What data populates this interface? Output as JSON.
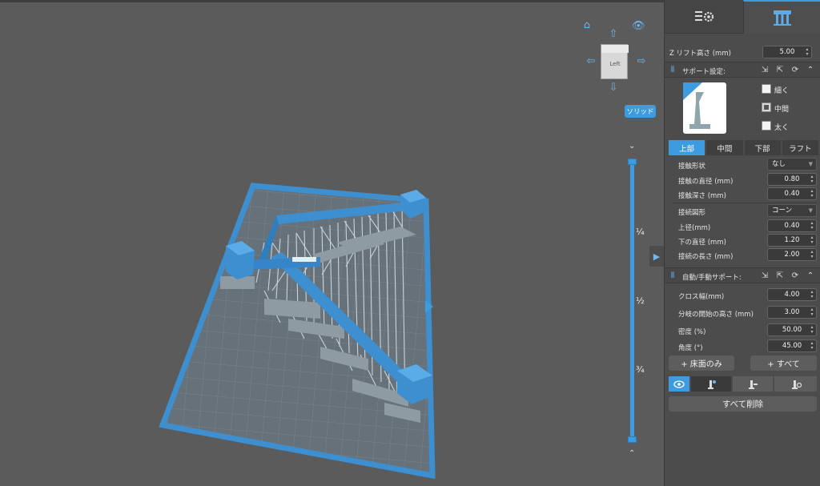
{
  "panel_tabs": [
    {
      "name": "print-settings",
      "icon": "sliders-gear-icon"
    },
    {
      "name": "supports",
      "icon": "support-pillars-icon"
    }
  ],
  "z_lift": {
    "label": "Z リフト高さ (mm)",
    "value": "5.00"
  },
  "support_settings": {
    "title": "サポート設定:",
    "density_options": [
      {
        "label": "細く",
        "checked": false
      },
      {
        "label": "中間",
        "checked": true
      },
      {
        "label": "太く",
        "checked": false
      }
    ],
    "tabs": [
      "上部",
      "中間",
      "下部",
      "ラフト"
    ],
    "active_tab": "上部",
    "fields": {
      "contact_shape": {
        "label": "接触形状",
        "value": "なし"
      },
      "contact_diameter": {
        "label": "接触の直径 (mm)",
        "value": "0.80"
      },
      "contact_depth": {
        "label": "接触深さ (mm)",
        "value": "0.40"
      },
      "connection_shape": {
        "label": "接続図形",
        "value": "コーン"
      },
      "upper_diameter": {
        "label": "上径(mm)",
        "value": "0.40"
      },
      "lower_diameter": {
        "label": "下の直径 (mm)",
        "value": "1.20"
      },
      "connection_length": {
        "label": "接続の長さ (mm)",
        "value": "2.00"
      }
    }
  },
  "auto_support": {
    "title": "自動/手動サポート:",
    "fields": {
      "cross_width": {
        "label": "クロス幅(mm)",
        "value": "4.00"
      },
      "branch_height": {
        "label": "分岐の開始の高さ (mm)",
        "value": "3.00"
      },
      "density": {
        "label": "密度 (%)",
        "value": "50.00"
      },
      "angle": {
        "label": "角度 (°)",
        "value": "45.00"
      }
    },
    "buttons": {
      "bed_only": "+ 床面のみ",
      "all": "+ すべて"
    },
    "delete_all": "すべて削除"
  },
  "viewport": {
    "view_cube_label": "Left",
    "solid_button": "ソリッド",
    "slider_marks": [
      "¼",
      "½",
      "¾"
    ]
  },
  "colors": {
    "accent": "#3d9be0",
    "panel_bg": "#4c4c4c",
    "viewport_bg": "#5b5b5b"
  }
}
